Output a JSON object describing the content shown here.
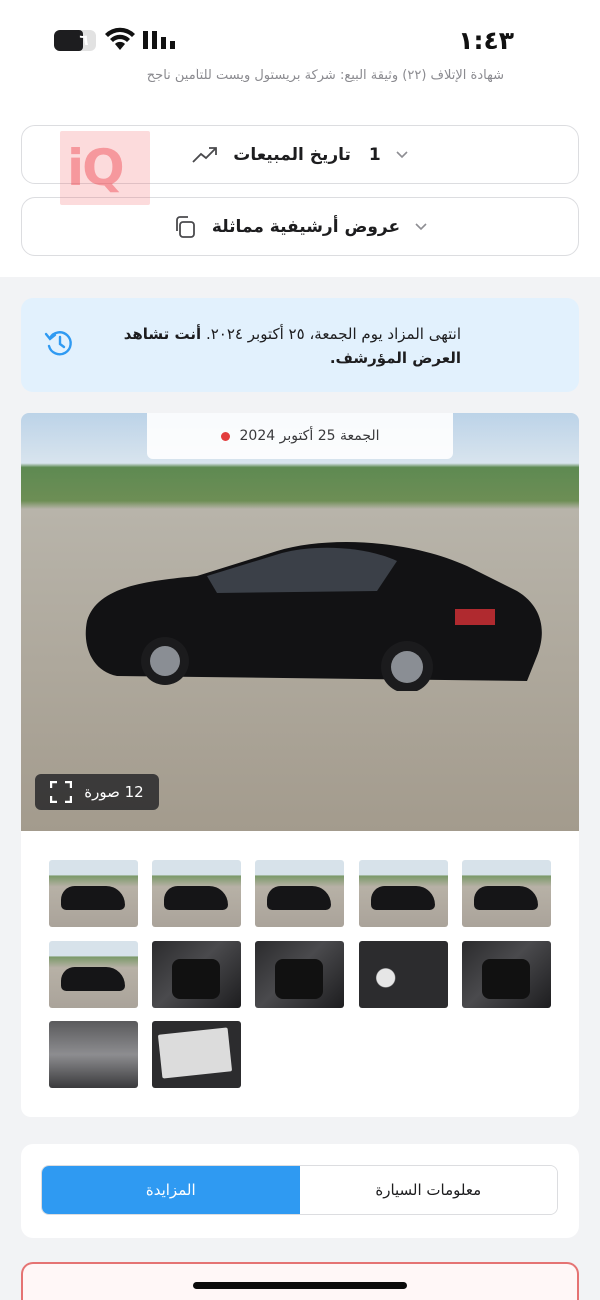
{
  "status_bar": {
    "time": "١:٤٣",
    "battery_level": "٦"
  },
  "peek_text": "شهادة الإتلاف (٢٢) وثيقة البيع: شركة بريستول ويست للتأمين ناجح",
  "accordions": [
    {
      "label": "تاريخ المبيعات",
      "count": "1",
      "icon": "trend-up-icon"
    },
    {
      "label": "عروض أرشيفية مماثلة",
      "icon": "copy-icon"
    }
  ],
  "watermark": "iQ",
  "notice": {
    "bold": "أنت تشاهد العرض المؤرشف.",
    "text": "انتهى المزاد يوم الجمعة، ٢٥ أكتوبر ٢٠٢٤."
  },
  "gallery": {
    "date_label": "الجمعة 25 أكتوبر 2024",
    "photo_count": "12 صورة",
    "thumbnails": [
      {
        "kind": "exterior",
        "desc": "front-left"
      },
      {
        "kind": "exterior",
        "desc": "left-side"
      },
      {
        "kind": "exterior",
        "desc": "rear-left"
      },
      {
        "kind": "exterior",
        "desc": "front-right"
      },
      {
        "kind": "exterior",
        "desc": "front"
      },
      {
        "kind": "exterior",
        "desc": "rear"
      },
      {
        "kind": "interior",
        "desc": "driver-seat"
      },
      {
        "kind": "interior",
        "desc": "dashboard"
      },
      {
        "kind": "interior",
        "desc": "gauges"
      },
      {
        "kind": "interior",
        "desc": "rear-seats"
      },
      {
        "kind": "engine",
        "desc": "engine-bay"
      },
      {
        "kind": "label",
        "desc": "vin-label"
      }
    ]
  },
  "tabs": {
    "active": "المزايدة",
    "inactive": "معلومات السيارة"
  },
  "colors": {
    "accent": "#2f9af2",
    "notice_bg": "#e2f1fd",
    "alert_border": "#e57373"
  }
}
